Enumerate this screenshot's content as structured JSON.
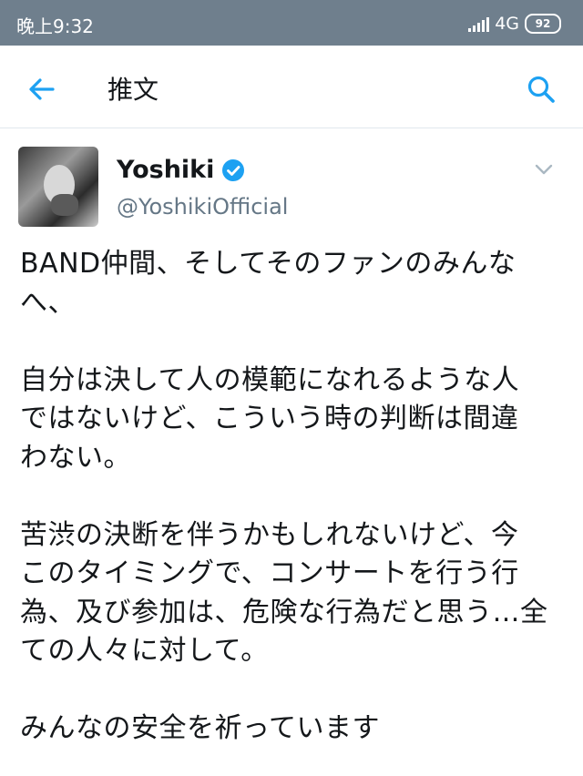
{
  "status_bar": {
    "time": "晚上9:32",
    "network": "4G",
    "battery": "92"
  },
  "app_bar": {
    "title": "推文",
    "back_icon": "arrow-left-icon",
    "search_icon": "search-icon"
  },
  "tweet": {
    "author_name": "Yoshiki",
    "author_handle": "@YoshikiOfficial",
    "verified": true,
    "text": "BAND仲間、そしてそのファンのみんな\nへ、\n\n自分は決して人の模範になれるような人\nではないけど、こういう時の判断は間違\nわない。\n\n苦渋の決断を伴うかもしれないけど、今\nこのタイミングで、コンサートを行う行\n為、及び参加は、危険な行為だと思う…全\nての人々に対して。\n\nみんなの安全を祈っています"
  },
  "colors": {
    "status_bar": "#6f7f8d",
    "accent": "#1da1f2",
    "text": "#14171a",
    "secondary_text": "#657786"
  }
}
